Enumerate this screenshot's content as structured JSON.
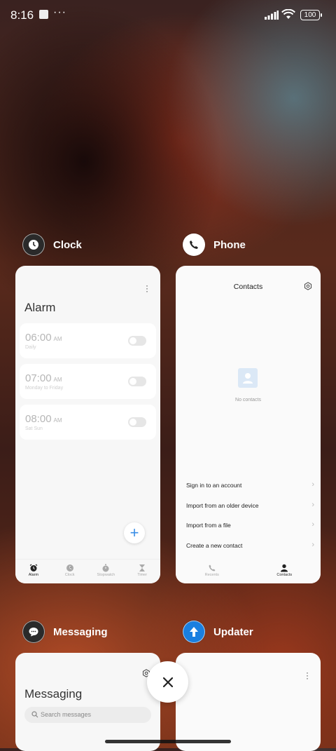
{
  "status_bar": {
    "time": "8:16",
    "battery": "100"
  },
  "apps": {
    "clock": {
      "name": "Clock",
      "screen_title": "Alarm",
      "alarms": [
        {
          "time": "06:00",
          "ampm": "AM",
          "repeat": "Daily"
        },
        {
          "time": "07:00",
          "ampm": "AM",
          "repeat": "Monday to Friday"
        },
        {
          "time": "08:00",
          "ampm": "AM",
          "repeat": "Sat Sun"
        }
      ],
      "fab_label": "+",
      "nav": [
        "Alarm",
        "Clock",
        "Stopwatch",
        "Timer"
      ]
    },
    "phone": {
      "name": "Phone",
      "screen_title": "Contacts",
      "empty_text": "No contacts",
      "options": [
        "Sign in to an account",
        "Import from an older device",
        "Import from a file",
        "Create a new contact"
      ],
      "nav": [
        "Recents",
        "Contacts"
      ]
    },
    "messaging": {
      "name": "Messaging",
      "screen_title": "Messaging",
      "search_placeholder": "Search messages"
    },
    "updater": {
      "name": "Updater"
    }
  },
  "colors": {
    "accent": "#3a8ee6",
    "card_bg": "#f7f7f7"
  },
  "icons": [
    "clock-icon",
    "phone-icon",
    "messaging-icon",
    "updater-icon",
    "close-icon",
    "gear-icon",
    "search-icon"
  ]
}
